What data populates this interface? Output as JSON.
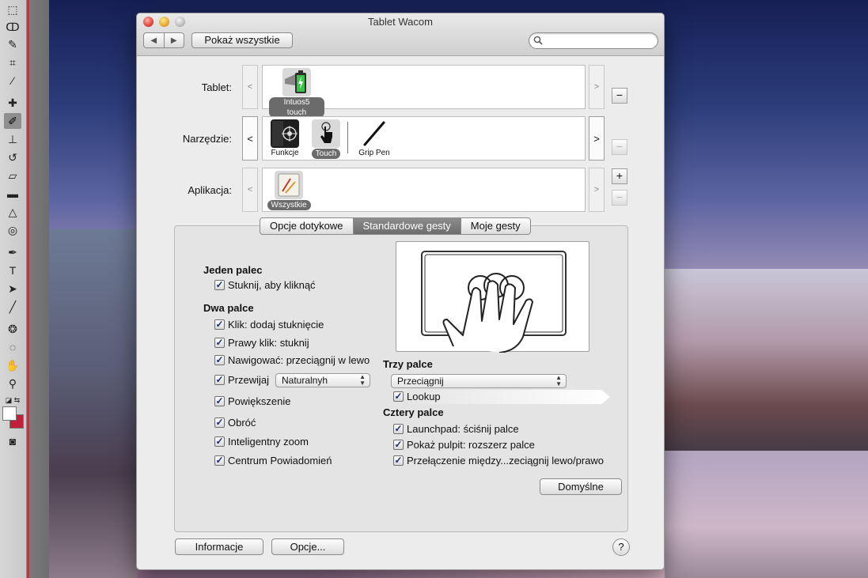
{
  "window": {
    "title": "Tablet Wacom",
    "show_all": "Pokaż wszystkie",
    "nav_back": "◀",
    "nav_forward": "▶",
    "search_placeholder": ""
  },
  "rows": {
    "tablet": {
      "label": "Tablet:",
      "items": [
        {
          "name": "Intuos5 touch",
          "selected": true
        }
      ]
    },
    "tool": {
      "label": "Narzędzie:",
      "items": [
        {
          "name": "Funkcje",
          "selected": false
        },
        {
          "name": "Touch",
          "selected": true
        },
        {
          "name": "Grip Pen",
          "selected": false
        }
      ]
    },
    "app": {
      "label": "Aplikacja:",
      "items": [
        {
          "name": "Wszystkie",
          "selected": true
        }
      ]
    },
    "prev": "<",
    "next": ">"
  },
  "tabs": [
    "Opcje dotykowe",
    "Standardowe gesty",
    "Moje gesty"
  ],
  "active_tab": 1,
  "one_finger": {
    "title": "Jeden palec",
    "items": [
      {
        "label": "Stuknij, aby kliknąć",
        "checked": true
      }
    ]
  },
  "two_fingers": {
    "title": "Dwa palce",
    "items": [
      {
        "label": "Klik: dodaj stuknięcie",
        "checked": true
      },
      {
        "label": "Prawy klik: stuknij",
        "checked": true
      },
      {
        "label": "Nawigować: przeciągnij w lewo",
        "checked": true
      },
      {
        "label": "Przewijaj",
        "checked": true
      },
      {
        "label": "Powiększenie",
        "checked": true
      },
      {
        "label": "Obróć",
        "checked": true
      },
      {
        "label": "Inteligentny zoom",
        "checked": true
      },
      {
        "label": "Centrum Powiadomień",
        "checked": true
      }
    ],
    "scroll_select": "Naturalnyh"
  },
  "three_fingers": {
    "title": "Trzy palce",
    "select": "Przeciągnij",
    "items": [
      {
        "label": "Lookup",
        "checked": true
      }
    ]
  },
  "four_fingers": {
    "title": "Cztery palce",
    "items": [
      {
        "label": "Launchpad: ściśnij palce",
        "checked": true
      },
      {
        "label": "Pokaż pulpit: rozszerz palce",
        "checked": true
      },
      {
        "label": "Przełączenie między...zeciągnij lewo/prawo",
        "checked": true
      }
    ]
  },
  "buttons": {
    "defaults": "Domyślne",
    "info": "Informacje",
    "options": "Opcje...",
    "help": "?",
    "plus": "+",
    "minus": "−"
  },
  "colors": {
    "accent_selected": "#6b6b6b",
    "checkmark": "#1a2e7a",
    "close": "#e2463b",
    "minimize": "#e9a92c"
  }
}
